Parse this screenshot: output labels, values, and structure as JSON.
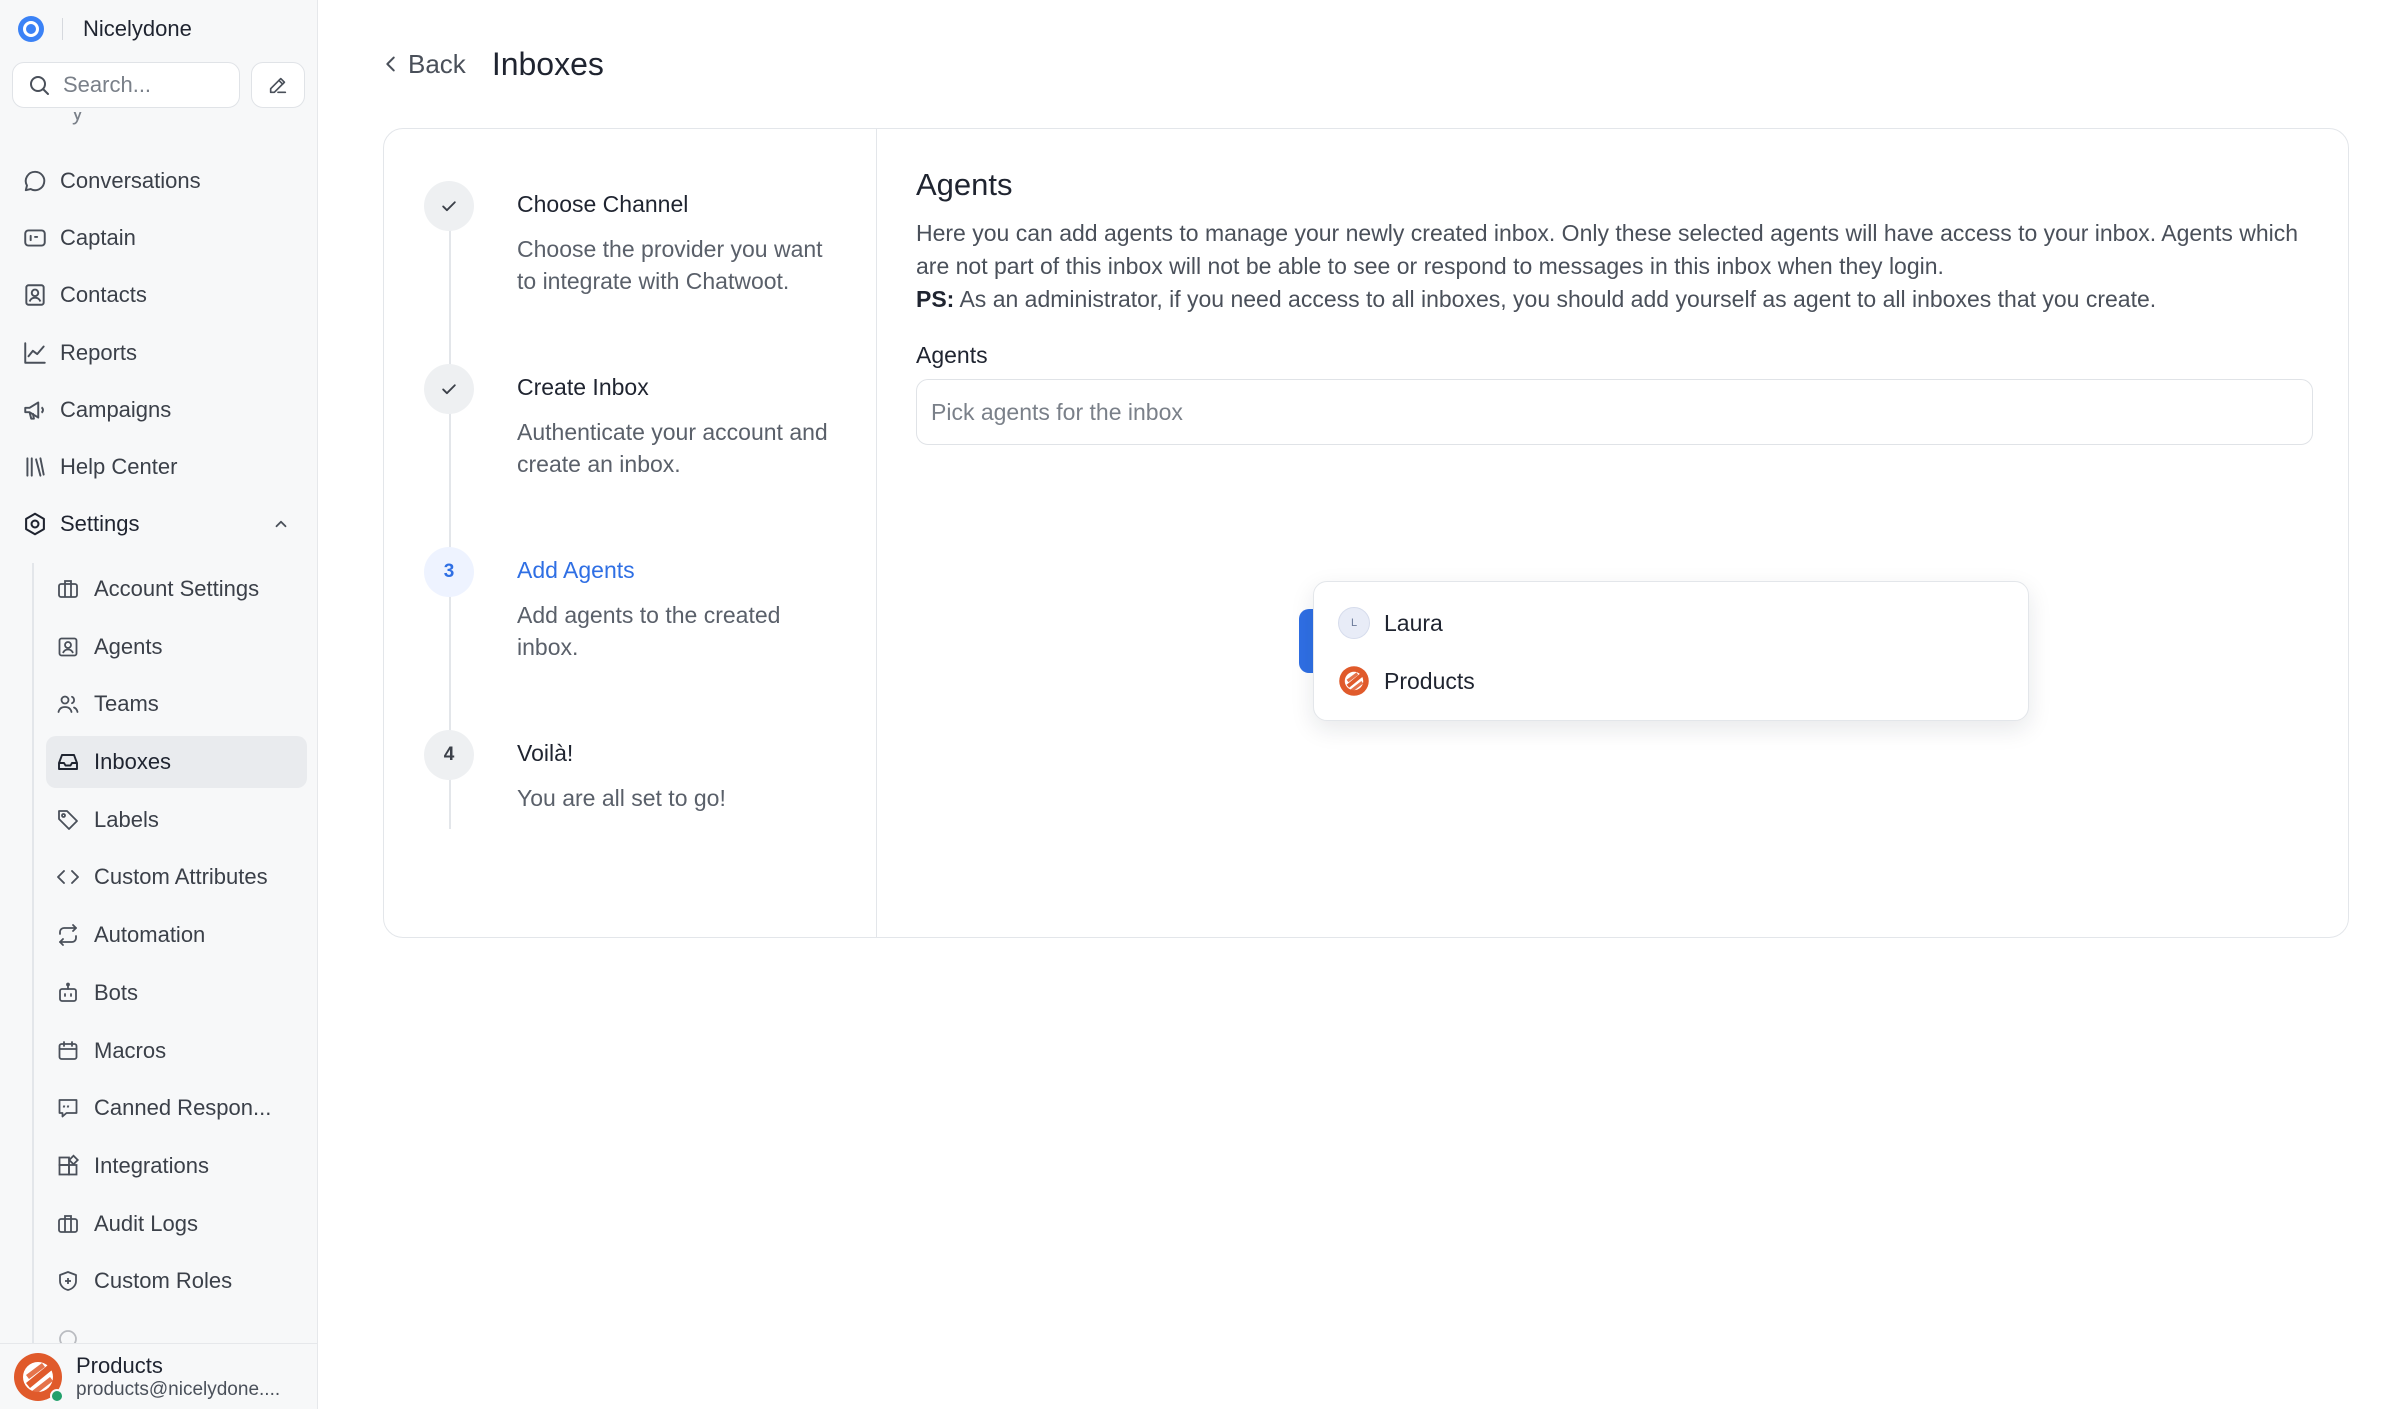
{
  "brand": {
    "name": "Nicelydone"
  },
  "search": {
    "placeholder": "Search..."
  },
  "sidebar": {
    "items": [
      {
        "label": "Conversations",
        "icon": "chat-bubble-icon"
      },
      {
        "label": "Captain",
        "icon": "captain-icon"
      },
      {
        "label": "Contacts",
        "icon": "contacts-icon"
      },
      {
        "label": "Reports",
        "icon": "chart-line-icon"
      },
      {
        "label": "Campaigns",
        "icon": "megaphone-icon"
      },
      {
        "label": "Help Center",
        "icon": "library-icon"
      },
      {
        "label": "Settings",
        "icon": "settings-gear-icon",
        "expanded": true
      }
    ],
    "settings_items": [
      {
        "label": "Account Settings",
        "icon": "briefcase-icon"
      },
      {
        "label": "Agents",
        "icon": "user-square-icon"
      },
      {
        "label": "Teams",
        "icon": "users-icon"
      },
      {
        "label": "Inboxes",
        "icon": "inbox-icon",
        "active": true
      },
      {
        "label": "Labels",
        "icon": "tag-icon"
      },
      {
        "label": "Custom Attributes",
        "icon": "code-icon"
      },
      {
        "label": "Automation",
        "icon": "repeat-icon"
      },
      {
        "label": "Bots",
        "icon": "bot-icon"
      },
      {
        "label": "Macros",
        "icon": "calendar-icon"
      },
      {
        "label": "Canned Respon...",
        "icon": "canned-message-icon"
      },
      {
        "label": "Integrations",
        "icon": "puzzle-icon"
      },
      {
        "label": "Audit Logs",
        "icon": "briefcase-icon"
      },
      {
        "label": "Custom Roles",
        "icon": "shield-icon"
      }
    ]
  },
  "profile": {
    "name": "Products",
    "email": "products@nicelydone...."
  },
  "header": {
    "back_label": "Back",
    "title": "Inboxes"
  },
  "steps": [
    {
      "number": "1",
      "title": "Choose Channel",
      "description": "Choose the provider you want to integrate with Chatwoot.",
      "state": "done"
    },
    {
      "number": "2",
      "title": "Create Inbox",
      "description": "Authenticate your account and create an inbox.",
      "state": "done"
    },
    {
      "number": "3",
      "title": "Add Agents",
      "description": "Add agents to the created inbox.",
      "state": "active"
    },
    {
      "number": "4",
      "title": "Voilà!",
      "description": "You are all set to go!",
      "state": "pending"
    }
  ],
  "agents_section": {
    "title": "Agents",
    "description": "Here you can add agents to manage your newly created inbox. Only these selected agents will have access to your inbox. Agents which are not part of this inbox will not be able to see or respond to messages in this inbox when they login.",
    "ps_label": "PS:",
    "ps_text": " As an administrator, if you need access to all inboxes, you should add yourself as agent to all inboxes that you create.",
    "field_label": "Agents",
    "placeholder": "Pick agents for the inbox"
  },
  "dropdown": {
    "options": [
      {
        "label": "Laura",
        "avatar_initial": "L"
      },
      {
        "label": "Products",
        "avatar": "products-logo"
      }
    ]
  },
  "colors": {
    "accent": "#2f6fe4",
    "brand": "#3b82f6",
    "products_logo": "#e05a2b",
    "online": "#22a06b"
  }
}
